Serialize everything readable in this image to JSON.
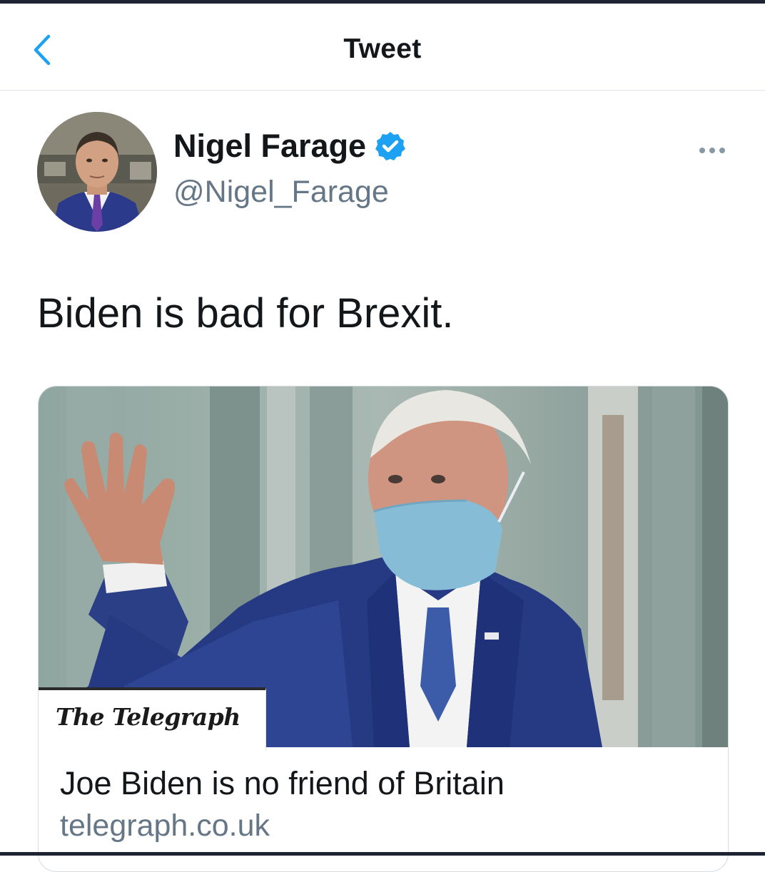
{
  "header": {
    "title": "Tweet",
    "back_icon": "chevron-left-icon"
  },
  "author": {
    "display_name": "Nigel Farage",
    "handle": "@Nigel_Farage",
    "verified": true,
    "verified_icon": "verified-badge-icon"
  },
  "tweet": {
    "text": "Biden is bad for Brexit."
  },
  "link_card": {
    "publisher_logo": "The Telegraph",
    "title": "Joe Biden is no friend of Britain",
    "domain": "telegraph.co.uk"
  },
  "colors": {
    "accent": "#1da1f2",
    "text_primary": "#14171a",
    "text_secondary": "#657786",
    "border": "#dfe3e8"
  }
}
